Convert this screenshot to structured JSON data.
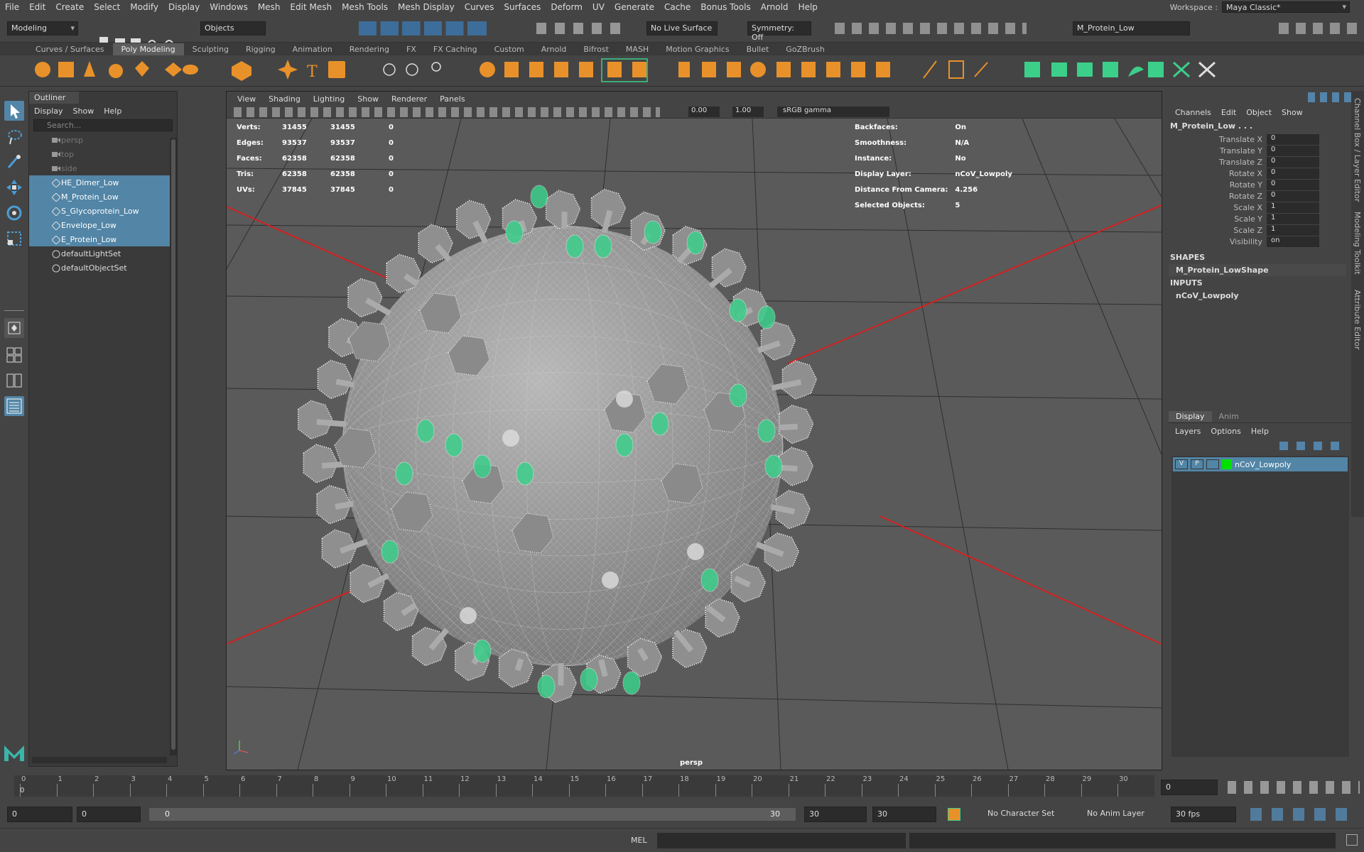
{
  "menubar": [
    "File",
    "Edit",
    "Create",
    "Select",
    "Modify",
    "Display",
    "Windows",
    "Mesh",
    "Edit Mesh",
    "Mesh Tools",
    "Mesh Display",
    "Curves",
    "Surfaces",
    "Deform",
    "UV",
    "Generate",
    "Cache",
    "Bonus Tools",
    "Arnold",
    "Help"
  ],
  "workspace": {
    "label": "Workspace :",
    "value": "Maya Classic*"
  },
  "status": {
    "mode": "Modeling",
    "select_mode": "Objects",
    "live_surface": "No Live Surface",
    "symmetry": "Symmetry: Off",
    "name_field": "M_Protein_Low"
  },
  "shelf_tabs": [
    "Curves / Surfaces",
    "Poly Modeling",
    "Sculpting",
    "Rigging",
    "Animation",
    "Rendering",
    "FX",
    "FX Caching",
    "Custom",
    "Arnold",
    "Bifrost",
    "MASH",
    "Motion Graphics",
    "Bullet",
    "GoZBrush"
  ],
  "outliner": {
    "title": "Outliner",
    "menu": [
      "Display",
      "Show",
      "Help"
    ],
    "search_placeholder": "Search...",
    "items": [
      {
        "label": "persp",
        "state": "dim",
        "icon": "camera-icon"
      },
      {
        "label": "top",
        "state": "dim",
        "icon": "camera-icon"
      },
      {
        "label": "side",
        "state": "dim",
        "icon": "camera-icon"
      },
      {
        "label": "HE_Dimer_Low",
        "state": "selected",
        "icon": "mesh-icon"
      },
      {
        "label": "M_Protein_Low",
        "state": "selected",
        "icon": "mesh-icon"
      },
      {
        "label": "S_Glycoprotein_Low",
        "state": "selected",
        "icon": "mesh-icon"
      },
      {
        "label": "Envelope_Low",
        "state": "selected",
        "icon": "mesh-icon"
      },
      {
        "label": "E_Protein_Low",
        "state": "selected",
        "icon": "mesh-icon"
      },
      {
        "label": "defaultLightSet",
        "state": "normal",
        "icon": "set-icon"
      },
      {
        "label": "defaultObjectSet",
        "state": "normal",
        "icon": "set-icon"
      }
    ]
  },
  "viewport": {
    "menu": [
      "View",
      "Shading",
      "Lighting",
      "Show",
      "Renderer",
      "Panels"
    ],
    "exposure": "0.00",
    "gamma": "1.00",
    "color_space": "sRGB gamma",
    "camera": "persp",
    "hud_left": [
      {
        "label": "Verts:",
        "a": "31455",
        "b": "31455",
        "c": "0"
      },
      {
        "label": "Edges:",
        "a": "93537",
        "b": "93537",
        "c": "0"
      },
      {
        "label": "Faces:",
        "a": "62358",
        "b": "62358",
        "c": "0"
      },
      {
        "label": "Tris:",
        "a": "62358",
        "b": "62358",
        "c": "0"
      },
      {
        "label": "UVs:",
        "a": "37845",
        "b": "37845",
        "c": "0"
      }
    ],
    "hud_right": [
      {
        "label": "Backfaces:",
        "value": "On"
      },
      {
        "label": "Smoothness:",
        "value": "N/A"
      },
      {
        "label": "Instance:",
        "value": "No"
      },
      {
        "label": "Display Layer:",
        "value": "nCoV_Lowpoly"
      },
      {
        "label": "Distance From Camera:",
        "value": "4.256"
      },
      {
        "label": "Selected Objects:",
        "value": "5"
      }
    ]
  },
  "channelbox": {
    "menu": [
      "Channels",
      "Edit",
      "Object",
      "Show"
    ],
    "object": "M_Protein_Low . . .",
    "attrs": [
      {
        "name": "Translate X",
        "value": "0"
      },
      {
        "name": "Translate Y",
        "value": "0"
      },
      {
        "name": "Translate Z",
        "value": "0"
      },
      {
        "name": "Rotate X",
        "value": "0"
      },
      {
        "name": "Rotate Y",
        "value": "0"
      },
      {
        "name": "Rotate Z",
        "value": "0"
      },
      {
        "name": "Scale X",
        "value": "1"
      },
      {
        "name": "Scale Y",
        "value": "1"
      },
      {
        "name": "Scale Z",
        "value": "1"
      },
      {
        "name": "Visibility",
        "value": "on"
      }
    ],
    "shapes_label": "SHAPES",
    "shape": "M_Protein_LowShape",
    "inputs_label": "INPUTS",
    "input": "nCoV_Lowpoly",
    "side_tabs": [
      "Channel Box / Layer Editor",
      "Modeling Toolkit",
      "Attribute Editor"
    ]
  },
  "layers": {
    "tabs": [
      "Display",
      "Anim"
    ],
    "menu": [
      "Layers",
      "Options",
      "Help"
    ],
    "row": {
      "v": "V",
      "p": "P",
      "name": "nCoV_Lowpoly",
      "color": "#00e000"
    }
  },
  "timeline": {
    "ticks": [
      "0",
      "1",
      "2",
      "3",
      "4",
      "5",
      "6",
      "7",
      "8",
      "9",
      "10",
      "11",
      "12",
      "13",
      "14",
      "15",
      "16",
      "17",
      "18",
      "19",
      "20",
      "21",
      "22",
      "23",
      "24",
      "25",
      "26",
      "27",
      "28",
      "29",
      "30"
    ],
    "current": "0",
    "current_field": "0"
  },
  "range": {
    "start": "0",
    "range_start": "0",
    "slider_start": "0",
    "slider_end": "30",
    "range_end": "30",
    "end": "30",
    "char_set": "No Character Set",
    "anim_layer": "No Anim Layer",
    "fps": "30 fps"
  },
  "cmdline": {
    "label": "MEL"
  },
  "colors": {
    "selection": "#5285a6",
    "accent_green": "#3ccf8a",
    "grid_red": "#d42020"
  }
}
